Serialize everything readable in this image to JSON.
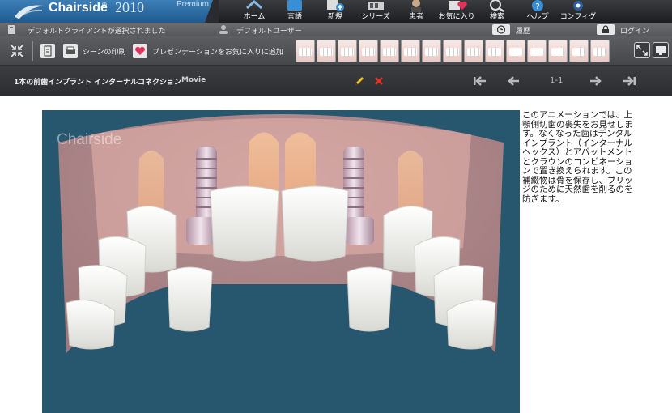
{
  "brand": {
    "name": "Chairside",
    "trademark": "®",
    "year": "2010",
    "edition": "Premium"
  },
  "nav": [
    {
      "label": "ホーム",
      "icon": "home-icon"
    },
    {
      "label": "言語",
      "icon": "language-icon"
    },
    {
      "label": "新規",
      "icon": "new-icon"
    },
    {
      "label": "シリーズ",
      "icon": "series-icon"
    },
    {
      "label": "患者",
      "icon": "patient-icon"
    },
    {
      "label": "お気に入り",
      "icon": "favorites-icon"
    },
    {
      "label": "検索",
      "icon": "search-icon"
    },
    {
      "label": "ヘルプ",
      "icon": "help-icon"
    },
    {
      "label": "コンフィグ",
      "icon": "config-icon"
    }
  ],
  "status": {
    "client": "デフォルトクライアントが選択されました",
    "user": "デフォルトユーザー",
    "history": "履歴",
    "login": "ログイン"
  },
  "toolbar": {
    "print_scene": "シーンの印刷",
    "add_favorite": "プレゼンテーションをお気に入りに追加"
  },
  "presentation": {
    "title": "1本の前歯インプラント インターナルコネクション",
    "type": "Movie",
    "page": "1-1"
  },
  "video": {
    "watermark": "Chairside"
  },
  "description": "このアニメーションでは、上顎側切歯の喪失をお見せします。なくなった歯はデンタルインプラント（インターナルヘックス）とアバットメントとクラウンのコンビネーションで置き換えられます。この補綴物は骨を保存し、ブリッジのために天然歯を削るのを防ぎます。",
  "colors": {
    "accent": "#2e6fa6",
    "edit": "#f0c419",
    "delete": "#e0332b"
  }
}
